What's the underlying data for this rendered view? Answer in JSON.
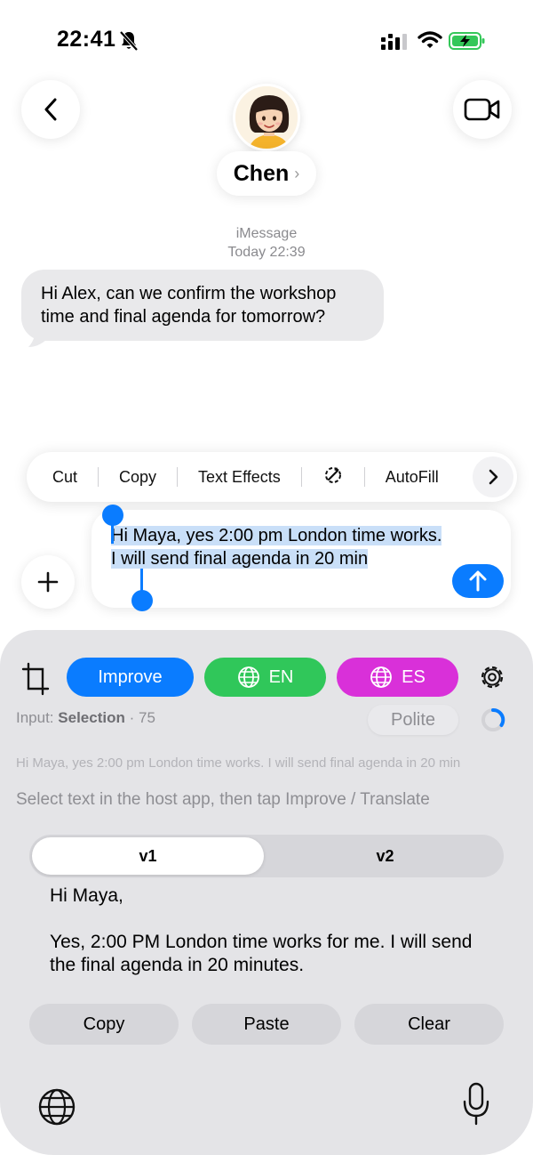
{
  "status_bar": {
    "time": "22:41"
  },
  "header": {
    "contact_name": "Chen"
  },
  "conversation": {
    "service": "iMessage",
    "timestamp": "Today 22:39",
    "incoming_message": "Hi Alex, can we confirm the workshop time and final agenda for tomorrow?"
  },
  "edit_menu": {
    "items": [
      "Cut",
      "Copy",
      "Text Effects",
      "AutoFill"
    ]
  },
  "compose": {
    "text": "Hi Maya, yes 2:00 pm London time works. I will send final agenda in 20 min"
  },
  "keyboard": {
    "improve_label": "Improve",
    "en_label": "EN",
    "es_label": "ES",
    "input_prefix": "Input:",
    "input_source": "Selection",
    "input_count": "· 75",
    "tone": "Polite",
    "preview_text": "Hi Maya, yes 2:00 pm London time works. I will send final agenda in 20 min",
    "hint": "Select text in the host app, then tap Improve / Translate",
    "tabs": [
      "v1",
      "v2"
    ],
    "result_greeting": "Hi Maya,",
    "result_body": "Yes, 2:00 PM London time works for me. I will send the final agenda in 20 minutes.",
    "copy_label": "Copy",
    "paste_label": "Paste",
    "clear_label": "Clear"
  },
  "colors": {
    "accent_blue": "#0a7cff",
    "en_green": "#30c75a",
    "es_magenta": "#d930d9"
  }
}
